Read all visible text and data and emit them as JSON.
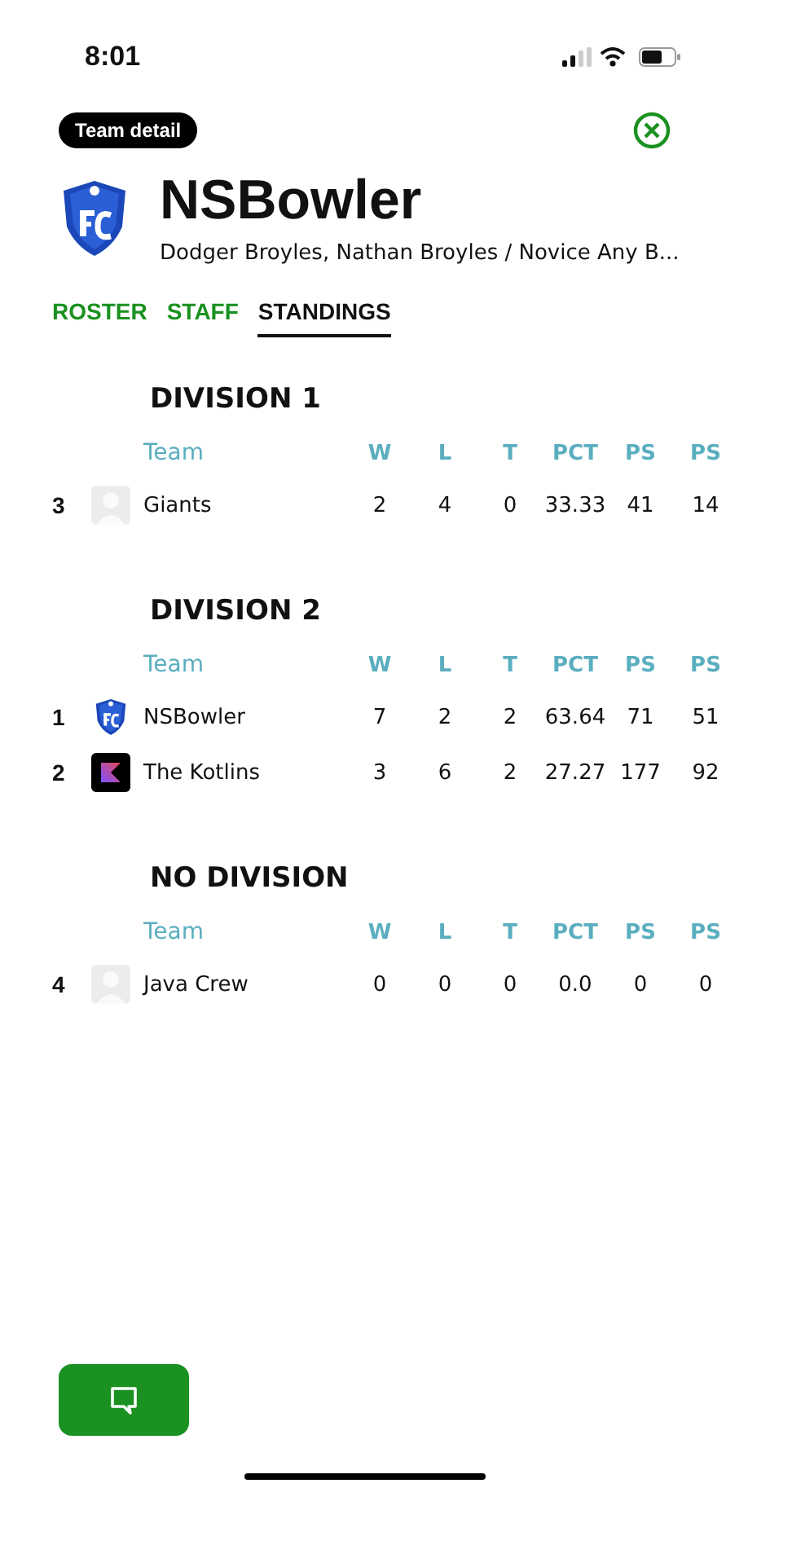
{
  "status_bar": {
    "time": "8:01"
  },
  "header": {
    "badge": "Team detail"
  },
  "team": {
    "name": "NSBowler",
    "subtitle": "Dodger Broyles, Nathan Broyles / Novice Any B..."
  },
  "tabs": [
    {
      "label": "ROSTER",
      "selected": false
    },
    {
      "label": "STAFF",
      "selected": false
    },
    {
      "label": "STANDINGS",
      "selected": true
    }
  ],
  "divisions": [
    {
      "title": "DIVISION 1",
      "columns": [
        "",
        "Team",
        "W",
        "L",
        "T",
        "PCT",
        "PS",
        "PS"
      ],
      "rows": [
        {
          "kind": "placeholder",
          "cells": [
            "3",
            "Giants",
            "2",
            "4",
            "0",
            "33.33",
            "41",
            "14"
          ]
        }
      ]
    },
    {
      "title": "DIVISION 2",
      "columns": [
        "",
        "Team",
        "W",
        "L",
        "T",
        "PCT",
        "PS",
        "PS"
      ],
      "rows": [
        {
          "kind": "shield",
          "cells": [
            "1",
            "NSBowler",
            "7",
            "2",
            "2",
            "63.64",
            "71",
            "51"
          ]
        },
        {
          "kind": "kotlin",
          "cells": [
            "2",
            "The Kotlins",
            "3",
            "6",
            "2",
            "27.27",
            "177",
            "92"
          ]
        }
      ]
    },
    {
      "title": "NO DIVISION",
      "columns": [
        "",
        "Team",
        "W",
        "L",
        "T",
        "PCT",
        "PS",
        "PS"
      ],
      "rows": [
        {
          "kind": "placeholder",
          "cells": [
            "4",
            "Java Crew",
            "0",
            "0",
            "0",
            "0.0",
            "0",
            "0"
          ]
        }
      ]
    }
  ]
}
